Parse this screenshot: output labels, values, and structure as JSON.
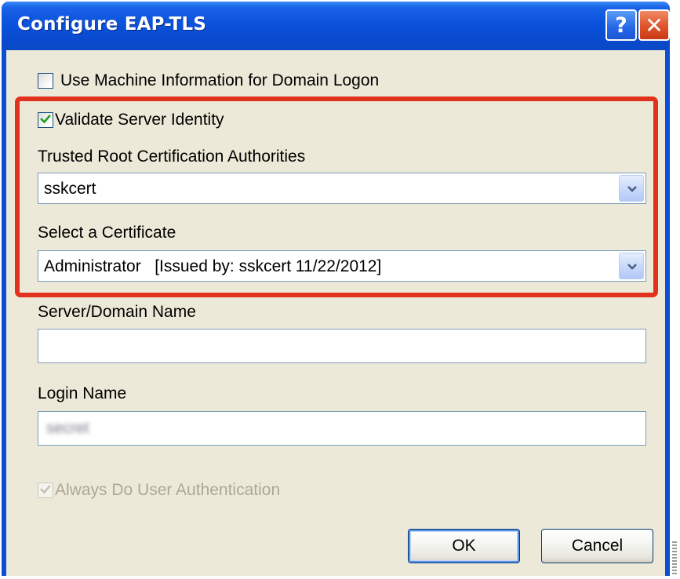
{
  "window": {
    "title": "Configure EAP-TLS",
    "help_label": "?",
    "close_label": "✕"
  },
  "options": {
    "use_machine_info": {
      "label": "Use Machine Information for Domain Logon",
      "checked": false
    },
    "validate_server": {
      "label": "Validate Server Identity",
      "checked": true
    },
    "always_user_auth": {
      "label": "Always Do User Authentication",
      "checked": true,
      "enabled": false
    }
  },
  "trusted_root": {
    "label": "Trusted Root Certification Authorities",
    "value": "sskcert"
  },
  "certificate": {
    "label": "Select a Certificate",
    "value": "Administrator   [Issued by: sskcert 11/22/2012]"
  },
  "server_domain": {
    "label": "Server/Domain Name",
    "value": ""
  },
  "login": {
    "label": "Login Name",
    "value_obscured": "secret"
  },
  "buttons": {
    "ok": "OK",
    "cancel": "Cancel"
  },
  "colors": {
    "titlebar": "#0a4bd0",
    "dialog_bg": "#ece9d8",
    "highlight_border": "#e1321d",
    "close_button": "#e0522a"
  }
}
